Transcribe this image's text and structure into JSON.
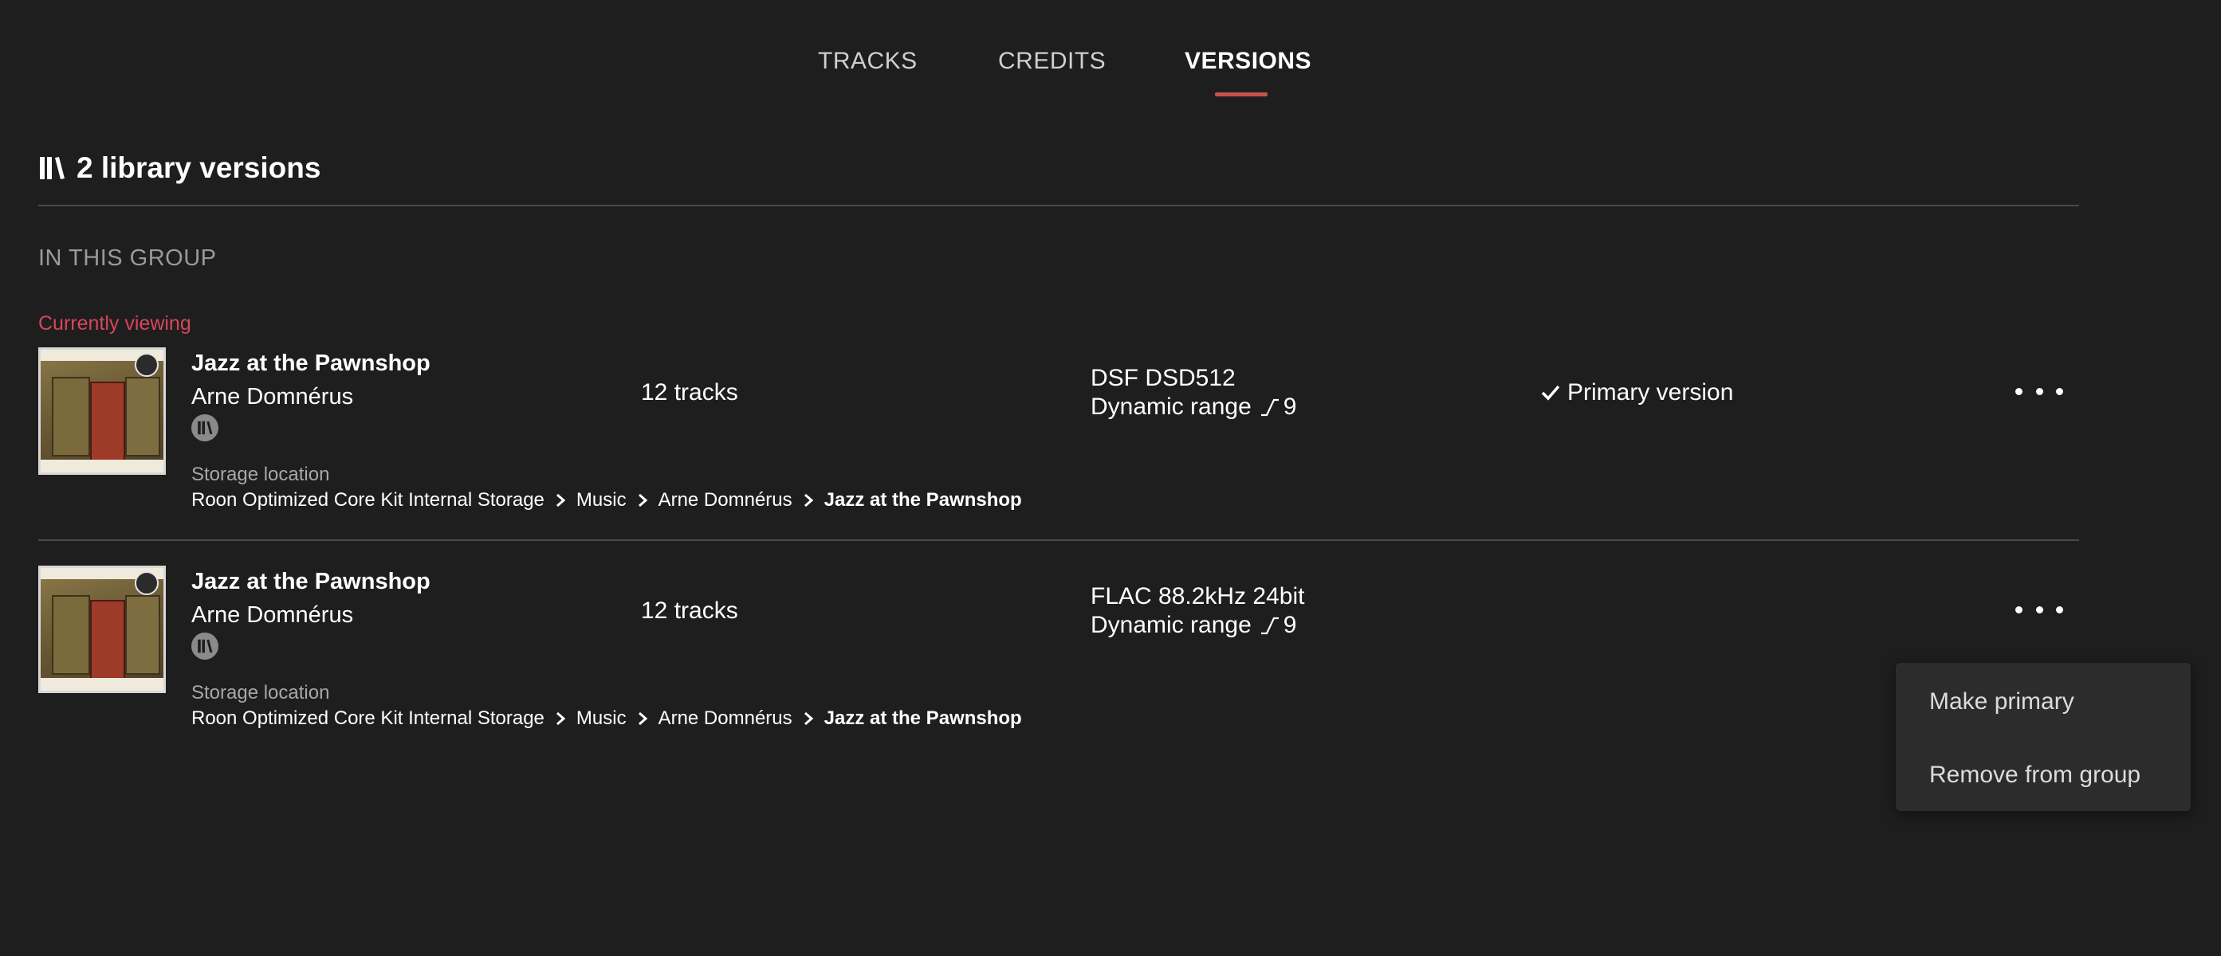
{
  "tabs": [
    {
      "label": "TRACKS",
      "active": false
    },
    {
      "label": "CREDITS",
      "active": false
    },
    {
      "label": "VERSIONS",
      "active": true
    }
  ],
  "header": {
    "icon": "library-icon",
    "title": "2 library versions"
  },
  "group_label": "IN THIS GROUP",
  "current_label": "Currently viewing",
  "versions": [
    {
      "album": "Jazz at the Pawnshop",
      "artist": "Arne Domnérus",
      "tracks": "12 tracks",
      "format": "DSF DSD512",
      "dynamic_range_label": "Dynamic range",
      "dynamic_range_value": "9",
      "primary_label": "Primary version",
      "storage_label": "Storage location",
      "path": [
        "Roon Optimized Core Kit Internal Storage",
        "Music",
        "Arne Domnérus",
        "Jazz at the Pawnshop"
      ]
    },
    {
      "album": "Jazz at the Pawnshop",
      "artist": "Arne Domnérus",
      "tracks": "12 tracks",
      "format": "FLAC 88.2kHz 24bit",
      "dynamic_range_label": "Dynamic range",
      "dynamic_range_value": "9",
      "primary_label": "",
      "storage_label": "Storage location",
      "path": [
        "Roon Optimized Core Kit Internal Storage",
        "Music",
        "Arne Domnérus",
        "Jazz at the Pawnshop"
      ]
    }
  ],
  "context_menu": {
    "items": [
      "Make primary",
      "Remove from group"
    ]
  },
  "colors": {
    "background": "#1e1e1e",
    "tab_underline": "#c8524b",
    "currently_viewing": "#d8455b",
    "menu_background": "#2c2c2c"
  }
}
